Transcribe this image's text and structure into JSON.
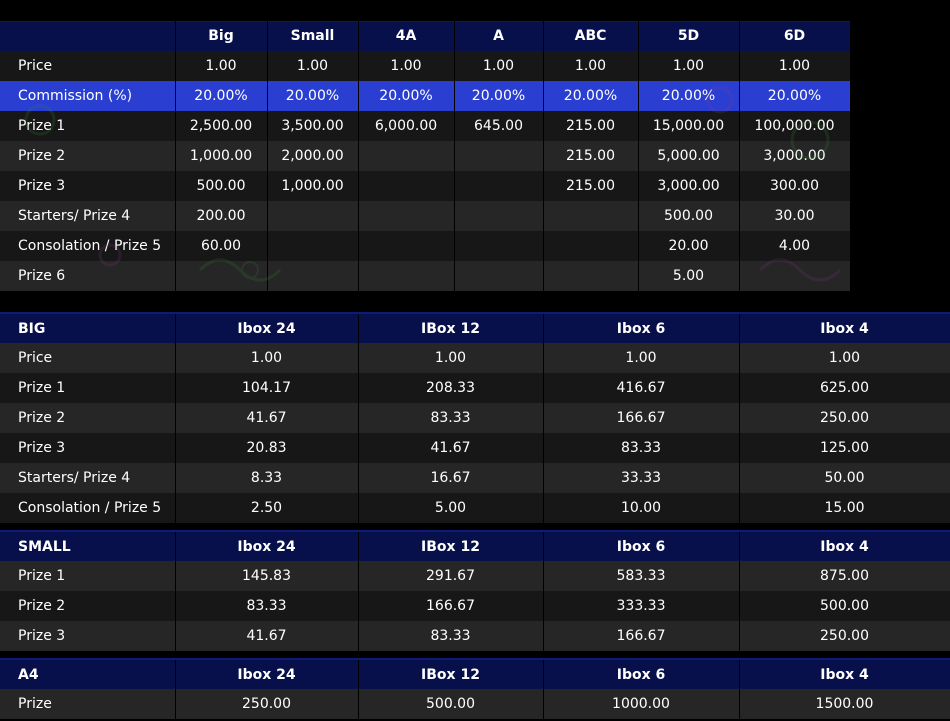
{
  "main_table": {
    "headers": [
      "",
      "Big",
      "Small",
      "4A",
      "A",
      "ABC",
      "5D",
      "6D"
    ],
    "rows": [
      {
        "label": "Price",
        "cells": [
          "1.00",
          "1.00",
          "1.00",
          "1.00",
          "1.00",
          "1.00",
          "1.00"
        ]
      },
      {
        "label": "Commission (%)",
        "cells": [
          "20.00%",
          "20.00%",
          "20.00%",
          "20.00%",
          "20.00%",
          "20.00%",
          "20.00%"
        ]
      },
      {
        "label": "Prize 1",
        "cells": [
          "2,500.00",
          "3,500.00",
          "6,000.00",
          "645.00",
          "215.00",
          "15,000.00",
          "100,000.00"
        ]
      },
      {
        "label": "Prize 2",
        "cells": [
          "1,000.00",
          "2,000.00",
          "",
          "",
          "215.00",
          "5,000.00",
          "3,000.00"
        ]
      },
      {
        "label": "Prize 3",
        "cells": [
          "500.00",
          "1,000.00",
          "",
          "",
          "215.00",
          "3,000.00",
          "300.00"
        ]
      },
      {
        "label": "Starters/ Prize 4",
        "cells": [
          "200.00",
          "",
          "",
          "",
          "",
          "500.00",
          "30.00"
        ]
      },
      {
        "label": "Consolation / Prize 5",
        "cells": [
          "60.00",
          "",
          "",
          "",
          "",
          "20.00",
          "4.00"
        ]
      },
      {
        "label": "Prize 6",
        "cells": [
          "",
          "",
          "",
          "",
          "",
          "5.00",
          ""
        ]
      }
    ]
  },
  "big_table": {
    "headers": [
      "BIG",
      "Ibox 24",
      "IBox 12",
      "Ibox 6",
      "Ibox 4"
    ],
    "rows": [
      {
        "label": "Price",
        "cells": [
          "1.00",
          "1.00",
          "1.00",
          "1.00"
        ]
      },
      {
        "label": "Prize 1",
        "cells": [
          "104.17",
          "208.33",
          "416.67",
          "625.00"
        ]
      },
      {
        "label": "Prize 2",
        "cells": [
          "41.67",
          "83.33",
          "166.67",
          "250.00"
        ]
      },
      {
        "label": "Prize 3",
        "cells": [
          "20.83",
          "41.67",
          "83.33",
          "125.00"
        ]
      },
      {
        "label": "Starters/ Prize 4",
        "cells": [
          "8.33",
          "16.67",
          "33.33",
          "50.00"
        ]
      },
      {
        "label": "Consolation / Prize 5",
        "cells": [
          "2.50",
          "5.00",
          "10.00",
          "15.00"
        ]
      }
    ]
  },
  "small_table": {
    "headers": [
      "SMALL",
      "Ibox 24",
      "IBox 12",
      "Ibox 6",
      "Ibox 4"
    ],
    "rows": [
      {
        "label": "Prize 1",
        "cells": [
          "145.83",
          "291.67",
          "583.33",
          "875.00"
        ]
      },
      {
        "label": "Prize 2",
        "cells": [
          "83.33",
          "166.67",
          "333.33",
          "500.00"
        ]
      },
      {
        "label": "Prize 3",
        "cells": [
          "41.67",
          "83.33",
          "166.67",
          "250.00"
        ]
      }
    ]
  },
  "a4_table": {
    "headers": [
      "A4",
      "Ibox 24",
      "IBox 12",
      "Ibox 6",
      "Ibox 4"
    ],
    "rows": [
      {
        "label": "Prize",
        "cells": [
          "250.00",
          "500.00",
          "1000.00",
          "1500.00"
        ]
      }
    ]
  },
  "colors": {
    "header_bg": "#07104a",
    "highlight_row": "#2a3fd1",
    "row_dark": "#171717",
    "row_light": "#262626"
  }
}
